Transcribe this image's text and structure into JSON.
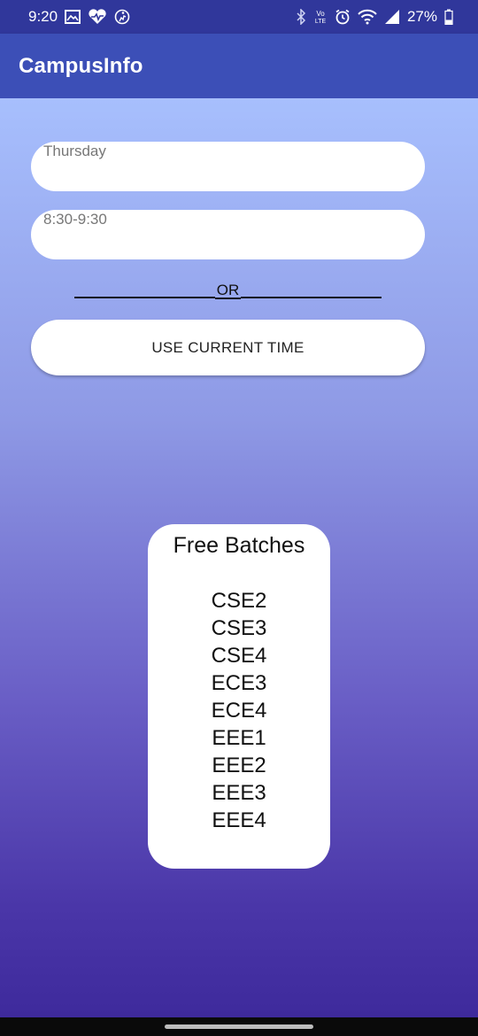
{
  "status_bar": {
    "time": "9:20",
    "battery": "27%",
    "left_icons": [
      "gallery-icon",
      "health-heart-icon",
      "activity-icon"
    ],
    "right_icons": [
      "bluetooth-icon",
      "volte-icon",
      "alarm-icon",
      "wifi-icon",
      "signal-icon",
      "battery-icon"
    ],
    "volte_label": "Vo LTE"
  },
  "app_bar": {
    "title": "CampusInfo",
    "color": "#3c4fb7"
  },
  "form": {
    "day_field": {
      "value": "Thursday"
    },
    "time_field": {
      "value": "8:30-9:30"
    },
    "divider_text": "OR",
    "current_time_button": "USE CURRENT TIME"
  },
  "free_batches": {
    "title": "Free Batches",
    "items": [
      "CSE2",
      "CSE3",
      "CSE4",
      "ECE3",
      "ECE4",
      "EEE1",
      "EEE2",
      "EEE3",
      "EEE4"
    ]
  },
  "colors": {
    "status_bar": "#30379b",
    "gradient_top": "#a7bffd",
    "gradient_bottom": "#3e2a9c"
  }
}
